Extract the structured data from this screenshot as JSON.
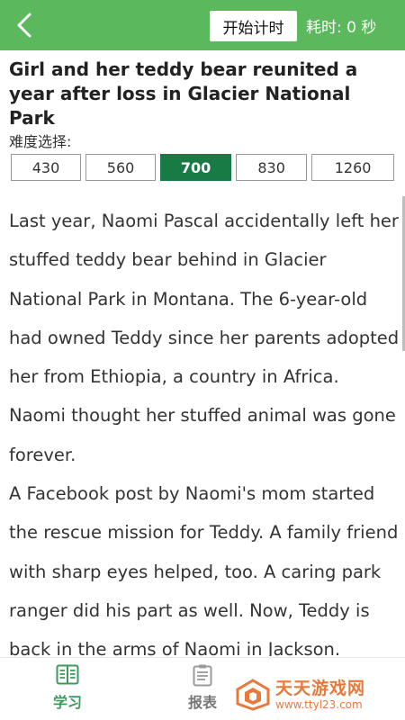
{
  "header": {
    "back_icon": "chevron-left-icon",
    "timer_button_label": "开始计时",
    "elapsed_text": "耗时: 0 秒"
  },
  "article": {
    "title": "Girl and her teddy bear reunited a year after loss in Glacier National Park",
    "paragraphs": [
      "Last year, Naomi Pascal accidentally left her stuffed teddy bear behind in Glacier National Park in Montana. The 6-year-old had owned Teddy since her parents adopted her from Ethiopia, a country in Africa. Naomi thought her stuffed animal was gone forever.",
      "A Facebook post by Naomi's mom started the rescue mission for Teddy. A family friend with sharp eyes helped, too. A caring park ranger did his part as well. Now, Teddy is back in the arms of Naomi in Jackson."
    ]
  },
  "difficulty": {
    "label": "难度选择:",
    "options": [
      "430",
      "560",
      "700",
      "830",
      "1260"
    ],
    "selected": "700",
    "active_color": "#187a45"
  },
  "bottom_nav": {
    "tabs": [
      {
        "label": "学习",
        "icon": "book-icon"
      },
      {
        "label": "报表",
        "icon": "clipboard-icon"
      }
    ]
  },
  "watermark": {
    "brand": "天天游戏网",
    "url": "www.ttyl23.com"
  },
  "colors": {
    "header_green": "#5cb85c",
    "tab_active_green": "#3e9a5c",
    "watermark_orange": "#e8793a"
  }
}
